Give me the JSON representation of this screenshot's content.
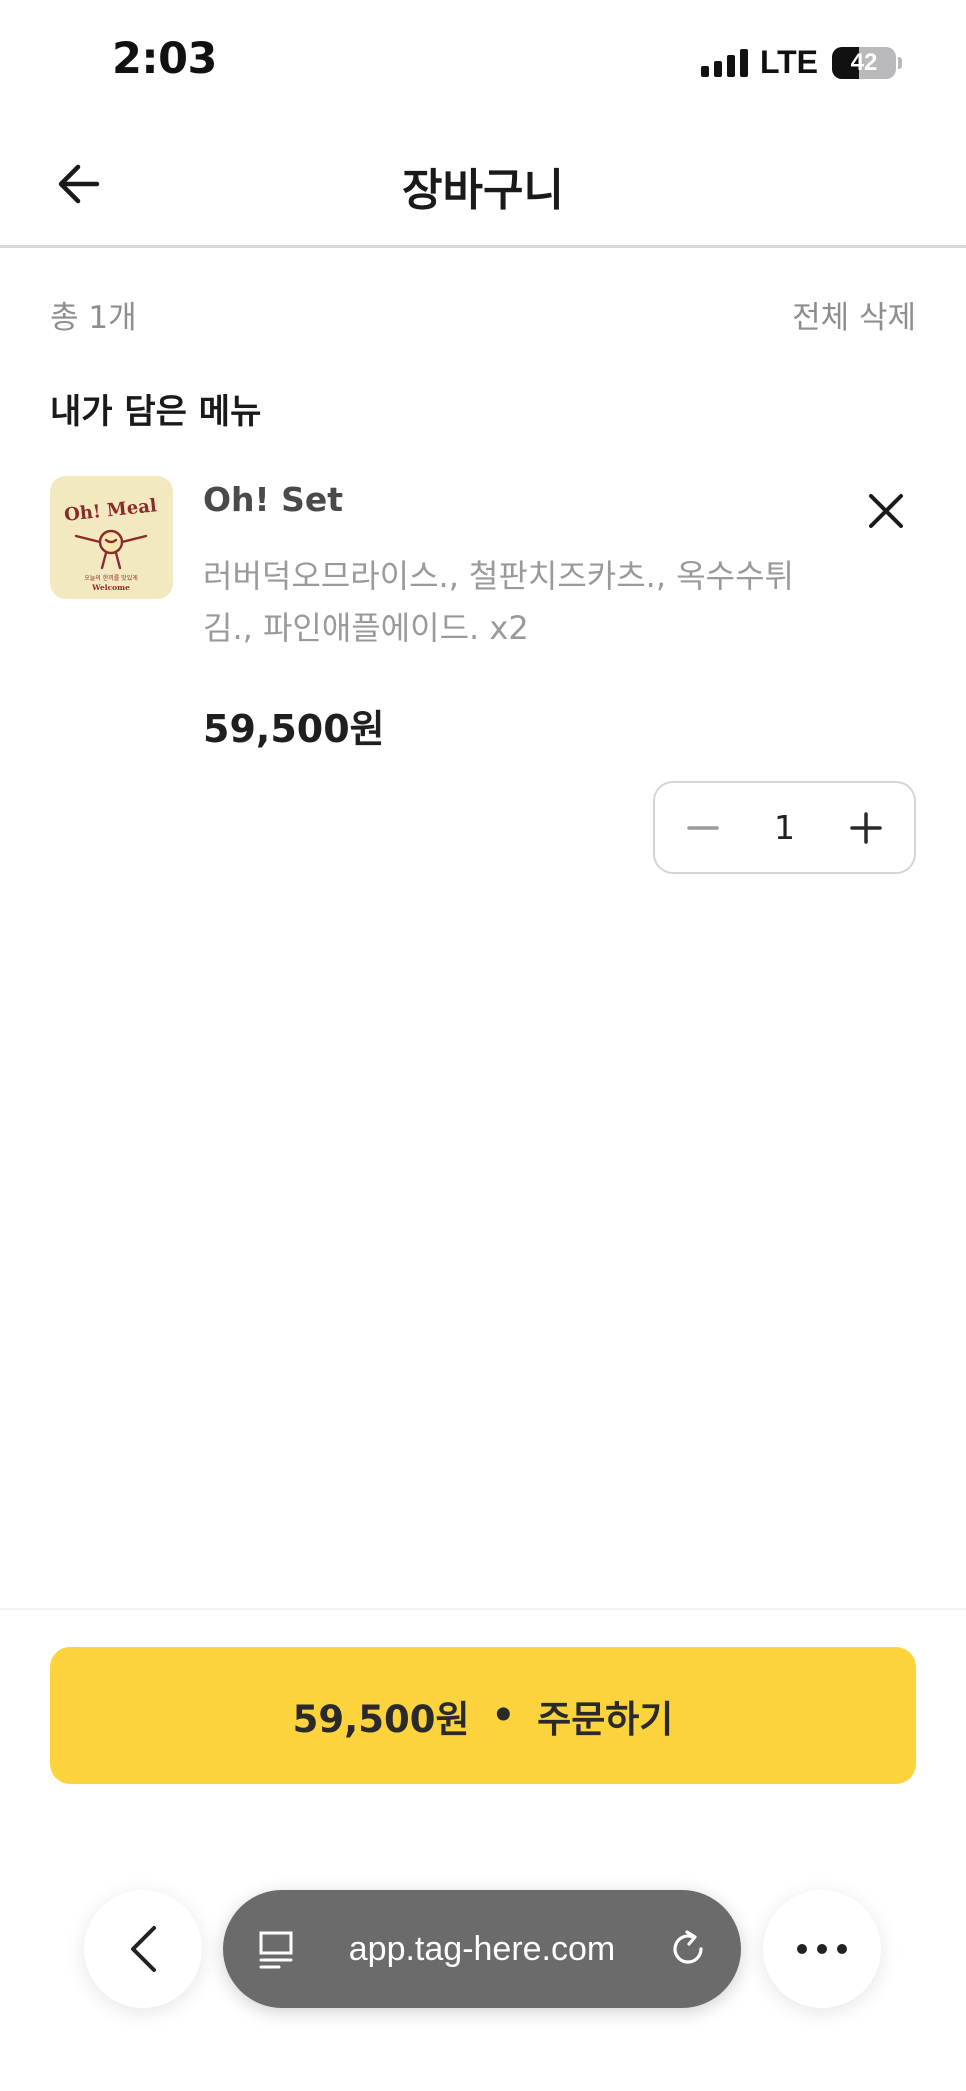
{
  "status_bar": {
    "time": "2:03",
    "network": "LTE",
    "battery_percent": "42",
    "battery_level": 0.42
  },
  "header": {
    "title": "장바구니",
    "back_icon": "arrow-left-icon"
  },
  "summary": {
    "count_label": "총 1개",
    "clear_all_label": "전체 삭제"
  },
  "section_title": "내가 담은 메뉴",
  "cart_items": [
    {
      "thumbnail": {
        "logo_text": "Oh! Meal",
        "tagline": "오늘의 한끼를 맛있게",
        "sign": "Welcome"
      },
      "name": "Oh! Set",
      "description": "러버덕오므라이스., 철판치즈카츠., 옥수수튀김., 파인애플에이드. x2",
      "price": "59,500원",
      "quantity": "1",
      "remove_icon": "close-icon",
      "decrease_icon": "minus-icon",
      "increase_icon": "plus-icon"
    }
  ],
  "order_button": {
    "price": "59,500원",
    "separator": "•",
    "label": "주문하기"
  },
  "browser": {
    "url": "app.tag-here.com",
    "back_icon": "chevron-left-icon",
    "tabs_icon": "reader-icon",
    "reload_icon": "reload-icon",
    "more_icon": "more-icon"
  },
  "colors": {
    "accent": "#fcd33d",
    "text_primary": "#1f1f1f",
    "text_secondary": "#9a9a9a",
    "url_pill": "#6b6b6b"
  }
}
